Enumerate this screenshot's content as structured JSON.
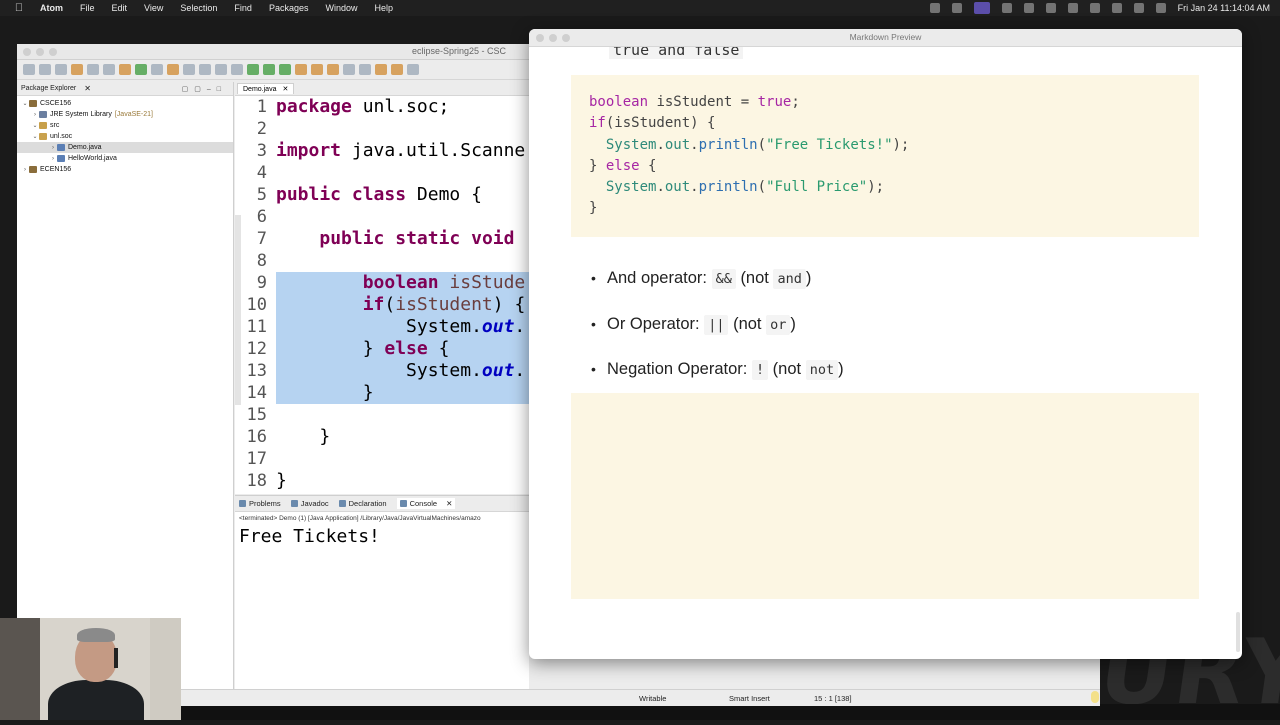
{
  "menubar": {
    "app": "Atom",
    "items": [
      "File",
      "Edit",
      "View",
      "Selection",
      "Find",
      "Packages",
      "Window",
      "Help"
    ],
    "clock": "Fri Jan 24  11:14:04 AM"
  },
  "eclipse": {
    "title": "eclipse-Spring25 - CSC",
    "package_explorer": {
      "tab": "Package Explorer",
      "tree": [
        {
          "label": "CSCE156",
          "depth": 0,
          "expanded": true,
          "kind": "project"
        },
        {
          "label": "JRE System Library",
          "suffix": "[JavaSE-21]",
          "depth": 1,
          "expanded": false,
          "kind": "library"
        },
        {
          "label": "src",
          "depth": 1,
          "expanded": true,
          "kind": "folder"
        },
        {
          "label": "unl.soc",
          "depth": 2,
          "expanded": true,
          "kind": "package"
        },
        {
          "label": "Demo.java",
          "depth": 3,
          "expanded": false,
          "kind": "file",
          "selected": true
        },
        {
          "label": "HelloWorld.java",
          "depth": 3,
          "expanded": false,
          "kind": "file"
        },
        {
          "label": "ECEN156",
          "depth": 0,
          "expanded": false,
          "kind": "project"
        }
      ]
    },
    "editor": {
      "tab": "Demo.java",
      "line_numbers": [
        "1",
        "2",
        "3",
        "4",
        "5",
        "6",
        "7",
        "8",
        "9",
        "10",
        "11",
        "12",
        "13",
        "14",
        "15",
        "16",
        "17",
        "18"
      ]
    },
    "console": {
      "tabs": [
        "Problems",
        "Javadoc",
        "Declaration",
        "Console"
      ],
      "terminated": "<terminated> Demo (1) [Java Application] /Library/Java/JavaVirtualMachines/amazo",
      "output": "Free Tickets!"
    },
    "status": {
      "writable": "Writable",
      "insert_mode": "Smart Insert",
      "position": "15 : 1 [138]"
    }
  },
  "markdown_preview": {
    "title": "Markdown Preview",
    "cut_text": "true and false",
    "bullets": [
      {
        "label": "And operator:",
        "code": "&&",
        "not_code": "and"
      },
      {
        "label": "Or Operator:",
        "code": "||",
        "not_code": "or"
      },
      {
        "label": "Negation Operator:",
        "code": "!",
        "not_code": "not"
      }
    ],
    "not_word": "(not"
  },
  "colors": {
    "code_block_bg": "#fcf6e3",
    "selection": "#b6d3f1",
    "keyword": "#7f0055"
  }
}
